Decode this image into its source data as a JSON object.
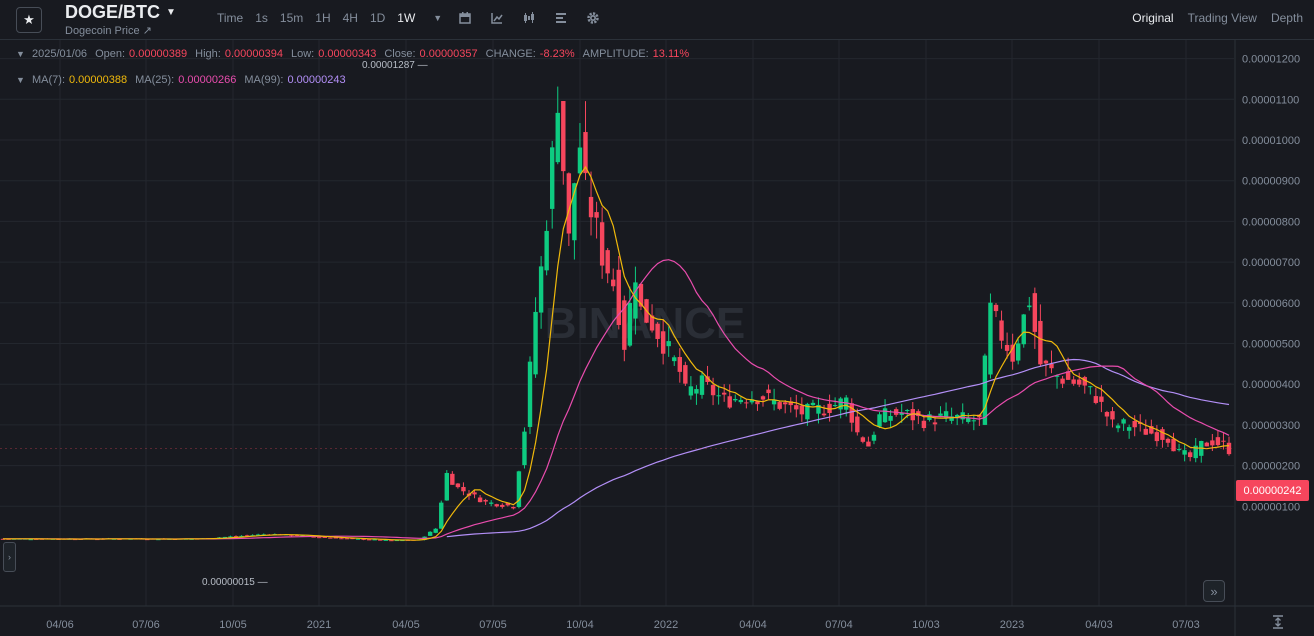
{
  "header": {
    "pair": "DOGE/BTC",
    "subtitle": "Dogecoin Price ↗",
    "intervals": [
      "Time",
      "1s",
      "15m",
      "1H",
      "4H",
      "1D",
      "1W"
    ],
    "active_interval": "1W",
    "tools": [
      "calendar-icon",
      "indicator-icon",
      "candle-style-icon",
      "layout-icon",
      "settings-icon"
    ],
    "views": [
      "Original",
      "Trading View",
      "Depth"
    ],
    "active_view": "Original"
  },
  "ohlc": {
    "date": "2025/01/06",
    "open_label": "Open:",
    "open": "0.00000389",
    "high_label": "High:",
    "high": "0.00000394",
    "low_label": "Low:",
    "low": "0.00000343",
    "close_label": "Close:",
    "close": "0.00000357",
    "change_label": "CHANGE:",
    "change": "-8.23%",
    "amplitude_label": "AMPLITUDE:",
    "amplitude": "13.11%"
  },
  "ma": {
    "ma7_label": "MA(7):",
    "ma7": "0.00000388",
    "ma25_label": "MA(25):",
    "ma25": "0.00000266",
    "ma99_label": "MA(99):",
    "ma99": "0.00000243"
  },
  "colors": {
    "up": "#0ecb81",
    "down": "#f6465d",
    "ma7": "#f0b90b",
    "ma25": "#e84cad",
    "ma99": "#b38ff7",
    "bg": "#181a20",
    "grid": "#23272e",
    "text": "#848e9c"
  },
  "watermark": "BINANCE",
  "chart_data": {
    "type": "candlestick",
    "y_axis_ticks": [
      "0.00000100",
      "0.00000200",
      "0.00000300",
      "0.00000400",
      "0.00000500",
      "0.00000600",
      "0.00000700",
      "0.00000800",
      "0.00000900",
      "0.00001000",
      "0.00001100",
      "0.00001200"
    ],
    "ylim": [
      0,
      1.34e-05
    ],
    "x_axis_ticks": [
      "04/06",
      "07/06",
      "10/05",
      "2021",
      "04/05",
      "07/05",
      "10/04",
      "2022",
      "04/04",
      "07/04",
      "10/03",
      "2023",
      "04/03",
      "07/03"
    ],
    "last_price": "0.00000242",
    "max_label": "0.00001287",
    "min_label": "0.00000015",
    "candle_anchors_close": [
      [
        0,
        2e-07
      ],
      [
        35,
        2e-07
      ],
      [
        48,
        3.2e-07
      ],
      [
        60,
        2.2e-07
      ],
      [
        70,
        1.6e-07
      ],
      [
        75,
        1.8e-07
      ],
      [
        78,
        4.5e-07
      ],
      [
        80,
        1.8e-06
      ],
      [
        82,
        1.45e-06
      ],
      [
        87,
        1.1e-06
      ],
      [
        92,
        1e-06
      ],
      [
        94,
        2.9e-06
      ],
      [
        96,
        5.8e-06
      ],
      [
        97,
        6.8e-06
      ],
      [
        99,
        9.5e-06
      ],
      [
        100,
        1.12e-05
      ],
      [
        102,
        7.5e-06
      ],
      [
        103,
        9e-06
      ],
      [
        104,
        9.9e-06
      ],
      [
        105,
        8.7e-06
      ],
      [
        106,
        8.3e-06
      ],
      [
        108,
        7.2e-06
      ],
      [
        110,
        6.5e-06
      ],
      [
        111,
        5.8e-06
      ],
      [
        112,
        5e-06
      ],
      [
        114,
        6.8e-06
      ],
      [
        115,
        5.8e-06
      ],
      [
        117,
        5.5e-06
      ],
      [
        120,
        4.8e-06
      ],
      [
        122,
        4.3e-06
      ],
      [
        123,
        3.8e-06
      ],
      [
        126,
        4e-06
      ],
      [
        130,
        3.6e-06
      ],
      [
        134,
        3.7e-06
      ],
      [
        137,
        3.7e-06
      ],
      [
        140,
        3.5e-06
      ],
      [
        144,
        3.3e-06
      ],
      [
        148,
        3.4e-06
      ],
      [
        152,
        3.6e-06
      ],
      [
        154,
        2.8e-06
      ],
      [
        156,
        2.5e-06
      ],
      [
        158,
        3.2e-06
      ],
      [
        162,
        3.3e-06
      ],
      [
        166,
        3.1e-06
      ],
      [
        170,
        3.2e-06
      ],
      [
        176,
        3.1e-06
      ],
      [
        178,
        5.8e-06
      ],
      [
        180,
        5.2e-06
      ],
      [
        182,
        4.7e-06
      ],
      [
        185,
        6.1e-06
      ],
      [
        187,
        4.5e-06
      ],
      [
        190,
        4.2e-06
      ],
      [
        194,
        4e-06
      ],
      [
        197,
        3.7e-06
      ],
      [
        200,
        3e-06
      ],
      [
        203,
        3e-06
      ],
      [
        207,
        2.8e-06
      ],
      [
        210,
        2.7e-06
      ],
      [
        212,
        2.3e-06
      ],
      [
        214,
        2.2e-06
      ],
      [
        216,
        2.5e-06
      ],
      [
        218,
        2.6e-06
      ],
      [
        220,
        2.5e-06
      ],
      [
        221,
        2.4e-06
      ]
    ]
  }
}
